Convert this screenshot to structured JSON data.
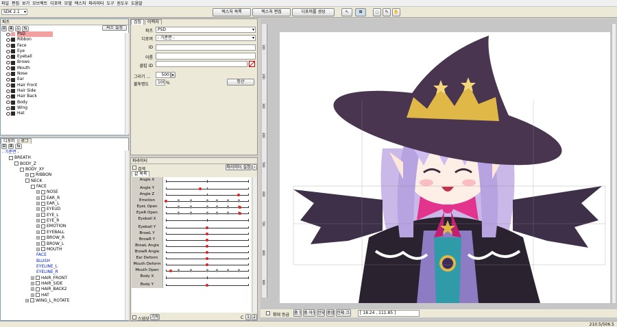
{
  "menu": [
    "파일",
    "편집",
    "보기",
    "오브젝트",
    "디포머",
    "모델",
    "텍스처",
    "파라미터",
    "도구",
    "윈도우",
    "도움말"
  ],
  "toolbar": {
    "sdk_select": "SDK 2.1",
    "texture_list": "텍스처 목록",
    "texture_edit": "텍스처 편집",
    "create_deformer": "디포머를 생성"
  },
  "parts_panel": {
    "title": "파츠",
    "setting_button": "파츠 설정",
    "items": [
      "PSD",
      "Ribbon",
      "Face",
      "Eye",
      "Eyeball",
      "Brows",
      "Mouth",
      "Nose",
      "Ear",
      "Hair Front",
      "Hair Side",
      "Hair Back",
      "Body",
      "Wing",
      "Hat"
    ]
  },
  "deformer_panel": {
    "tabs": [
      "디포머",
      "로그"
    ],
    "root": "- 기준면 -",
    "items": [
      {
        "label": "BREATH",
        "indent": 1,
        "plus": false,
        "cb": true,
        "blue": false
      },
      {
        "label": "BODY_Z",
        "indent": 2,
        "plus": false,
        "cb": true,
        "blue": false
      },
      {
        "label": "BODY_XY",
        "indent": 3,
        "plus": false,
        "cb": true,
        "blue": false
      },
      {
        "label": "RIBBON",
        "indent": 4,
        "plus": true,
        "cb": true,
        "blue": false
      },
      {
        "label": "NECK",
        "indent": 4,
        "plus": false,
        "cb": true,
        "blue": false
      },
      {
        "label": "FACE",
        "indent": 5,
        "plus": false,
        "cb": true,
        "blue": false
      },
      {
        "label": "NOSE",
        "indent": 6,
        "plus": true,
        "cb": true,
        "blue": false
      },
      {
        "label": "EAR_R",
        "indent": 6,
        "plus": true,
        "cb": true,
        "blue": false
      },
      {
        "label": "EAR_L",
        "indent": 6,
        "plus": true,
        "cb": true,
        "blue": false
      },
      {
        "label": "EYEUD",
        "indent": 6,
        "plus": true,
        "cb": true,
        "blue": false
      },
      {
        "label": "EYE_L",
        "indent": 6,
        "plus": true,
        "cb": true,
        "blue": false
      },
      {
        "label": "EYE_R",
        "indent": 6,
        "plus": true,
        "cb": true,
        "blue": false
      },
      {
        "label": "EMOTION",
        "indent": 6,
        "plus": true,
        "cb": true,
        "blue": false
      },
      {
        "label": "EYEBALL",
        "indent": 6,
        "plus": true,
        "cb": true,
        "blue": false
      },
      {
        "label": "BROW_R",
        "indent": 6,
        "plus": true,
        "cb": true,
        "blue": false
      },
      {
        "label": "BROW_L",
        "indent": 6,
        "plus": true,
        "cb": true,
        "blue": false
      },
      {
        "label": "MOUTH",
        "indent": 6,
        "plus": true,
        "cb": true,
        "blue": false
      },
      {
        "label": "FACE",
        "indent": 6,
        "plus": false,
        "cb": false,
        "blue": true
      },
      {
        "label": "BLUSH",
        "indent": 6,
        "plus": false,
        "cb": false,
        "blue": true
      },
      {
        "label": "EYELINE_L",
        "indent": 6,
        "plus": false,
        "cb": false,
        "blue": true
      },
      {
        "label": "EYELINE_R",
        "indent": 6,
        "plus": false,
        "cb": false,
        "blue": true
      },
      {
        "label": "HAIR_FRONT",
        "indent": 5,
        "plus": true,
        "cb": true,
        "blue": false
      },
      {
        "label": "HAIR_SIDE",
        "indent": 5,
        "plus": true,
        "cb": true,
        "blue": false
      },
      {
        "label": "HAIR_BACK2",
        "indent": 5,
        "plus": true,
        "cb": true,
        "blue": false
      },
      {
        "label": "HAT",
        "indent": 5,
        "plus": true,
        "cb": true,
        "blue": false
      },
      {
        "label": "WING_L_ROTATE",
        "indent": 4,
        "plus": true,
        "cb": true,
        "blue": false
      }
    ]
  },
  "inspector": {
    "tabs": [
      "검침",
      "이력라"
    ],
    "part_label": "파츠",
    "part_value": "PSD",
    "deformer_label": "디포머",
    "deformer_value": "- 기준면 -",
    "id_label": "ID",
    "name_label": "이름",
    "clip_label": "클립 ID",
    "draw_order_label": "그리기 ...",
    "draw_order_value": "500",
    "opacity_label": "불투명도",
    "opacity_value": "100",
    "opacity_unit": "%",
    "apply_button": "등산"
  },
  "param_panel": {
    "title": "파라미터",
    "search_label": "검색",
    "setting_button": "파라미터 설정",
    "tab_label": "값 목록",
    "rows": [
      {
        "label": "Angle X",
        "kind": "head"
      },
      {
        "label": "Angle Y",
        "kind": "track",
        "dot": 0.42
      },
      {
        "label": "Angle Z",
        "kind": "track",
        "dot": 0.88
      },
      {
        "label": "Emotion",
        "kind": "track",
        "dot": 0.0
      },
      {
        "label": "EyeL Open",
        "kind": "track",
        "dot": 0.9
      },
      {
        "label": "EyeR Open",
        "kind": "track",
        "dot": 0.9
      },
      {
        "label": "Eyeball X",
        "kind": "head"
      },
      {
        "label": "Eyeball Y",
        "kind": "track",
        "dot": 0.5
      },
      {
        "label": "BrowL Y",
        "kind": "track",
        "dot": 0.5
      },
      {
        "label": "BrowR Y",
        "kind": "track",
        "dot": 0.5
      },
      {
        "label": "BrowL Angle",
        "kind": "track",
        "dot": 0.5
      },
      {
        "label": "BrowR Angle",
        "kind": "track",
        "dot": 0.5
      },
      {
        "label": "Ear Deform",
        "kind": "track",
        "dot": 0.5
      },
      {
        "label": "Mouth Deform",
        "kind": "track",
        "dot": 0.5
      },
      {
        "label": "Mouth Open",
        "kind": "track",
        "dot": 0.06
      },
      {
        "label": "Body X",
        "kind": "head"
      },
      {
        "label": "Body Y",
        "kind": "track",
        "dot": 0.5
      }
    ],
    "footer_a": "스냅샷",
    "footer_b": "기억",
    "footer_c": "C",
    "page1": "1",
    "page2": "2"
  },
  "canvas_bottom": {
    "checkbox_label": "확대 등급",
    "buttons": [
      "줌 인",
      "줌 아웃",
      "전부",
      "중앙",
      "전체 크기"
    ],
    "coords": "[ 18.24 , 111.85 ]"
  },
  "ruler_left": [
    "100",
    "200",
    "300",
    "400",
    "500",
    "600",
    "700",
    "800",
    "900"
  ],
  "status": {
    "right": "210.5/506.5"
  },
  "colors": {
    "hat": "#4a3550",
    "hair": "#c9b8e8",
    "bow": "#e2348c",
    "wing": "#3e3048",
    "gold": "#e0b848"
  }
}
